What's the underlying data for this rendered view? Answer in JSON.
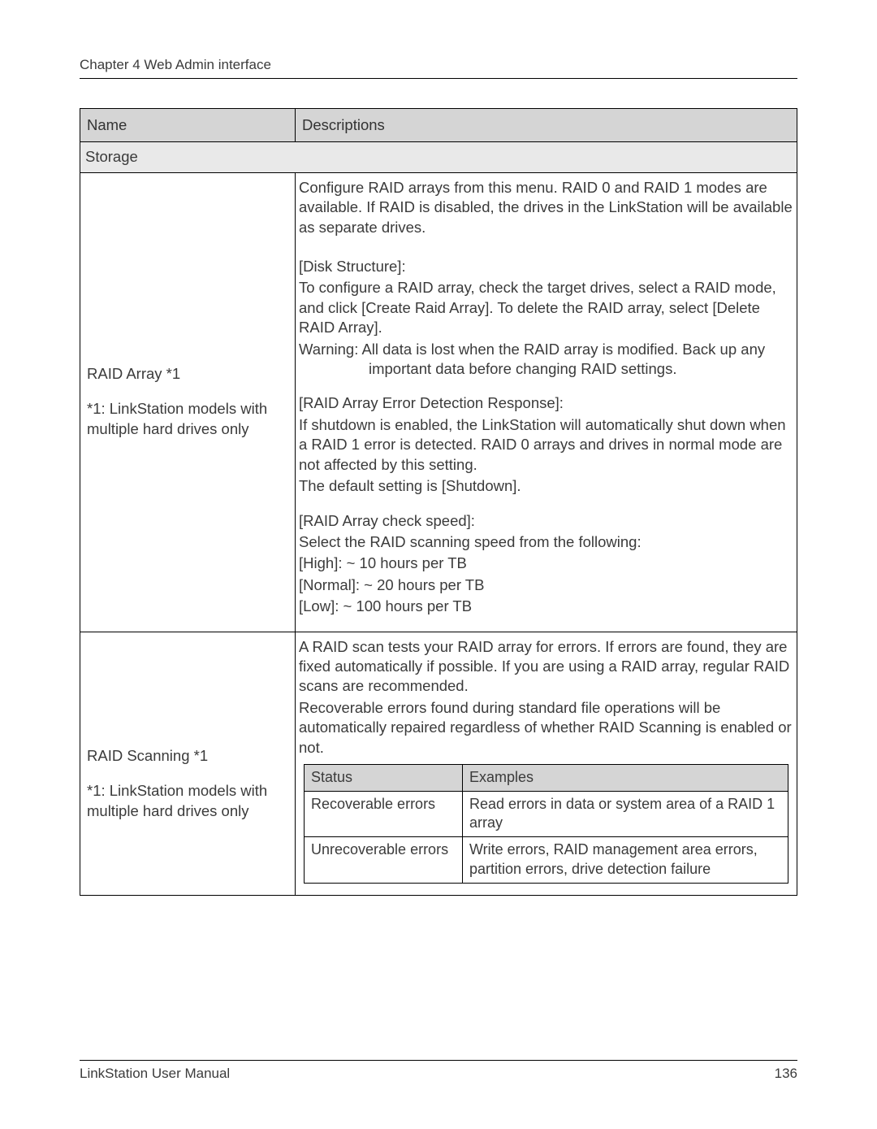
{
  "chapter_heading": "Chapter 4 Web Admin interface",
  "table": {
    "headers": {
      "name": "Name",
      "descriptions": "Descriptions"
    },
    "section": "Storage",
    "row1": {
      "name_line1": "RAID Array *1",
      "name_line2": "*1: LinkStation models with multiple hard drives only",
      "p1": "Configure RAID arrays from this menu. RAID 0 and RAID 1 modes are available. If RAID is disabled, the drives in the LinkStation will be available as separate drives.",
      "p2": "[Disk Structure]:",
      "p3": "To configure a RAID array, check the target drives, select a RAID mode, and click [Create Raid Array]. To delete the RAID array, select [Delete RAID Array].",
      "p4": "Warning:  All data is lost when the RAID array is modified.  Back up any important data before changing RAID settings.",
      "p5": "[RAID Array Error Detection Response]:",
      "p6": "If shutdown is enabled, the LinkStation will automatically shut down when a RAID 1 error is detected.  RAID 0 arrays and drives in normal mode are not affected by this setting.",
      "p7": "The default setting is [Shutdown].",
      "p8": "[RAID Array check speed]:",
      "p9": "Select the RAID scanning speed from the following:",
      "p10": "[High]: ~ 10 hours per TB",
      "p11": "[Normal]: ~ 20 hours per TB",
      "p12": "[Low]: ~ 100 hours per TB"
    },
    "row2": {
      "name_line1": "RAID Scanning *1",
      "name_line2": "*1: LinkStation models with multiple hard drives only",
      "p1": "A RAID scan tests your RAID array for errors. If errors are found, they are fixed automatically if possible. If you are using a RAID array, regular RAID scans are recommended.",
      "p2": "Recoverable errors found during standard file operations will be automatically repaired regardless of whether RAID Scanning is enabled or not.",
      "inner": {
        "h1": "Status",
        "h2": "Examples",
        "r1c1": "Recoverable errors",
        "r1c2": "Read errors in data or system area of a RAID 1 array",
        "r2c1": "Unrecoverable errors",
        "r2c2": "Write errors,  RAID management area errors, partition errors, drive detection failure"
      }
    }
  },
  "footer": {
    "left": "LinkStation User Manual",
    "right": "136"
  }
}
